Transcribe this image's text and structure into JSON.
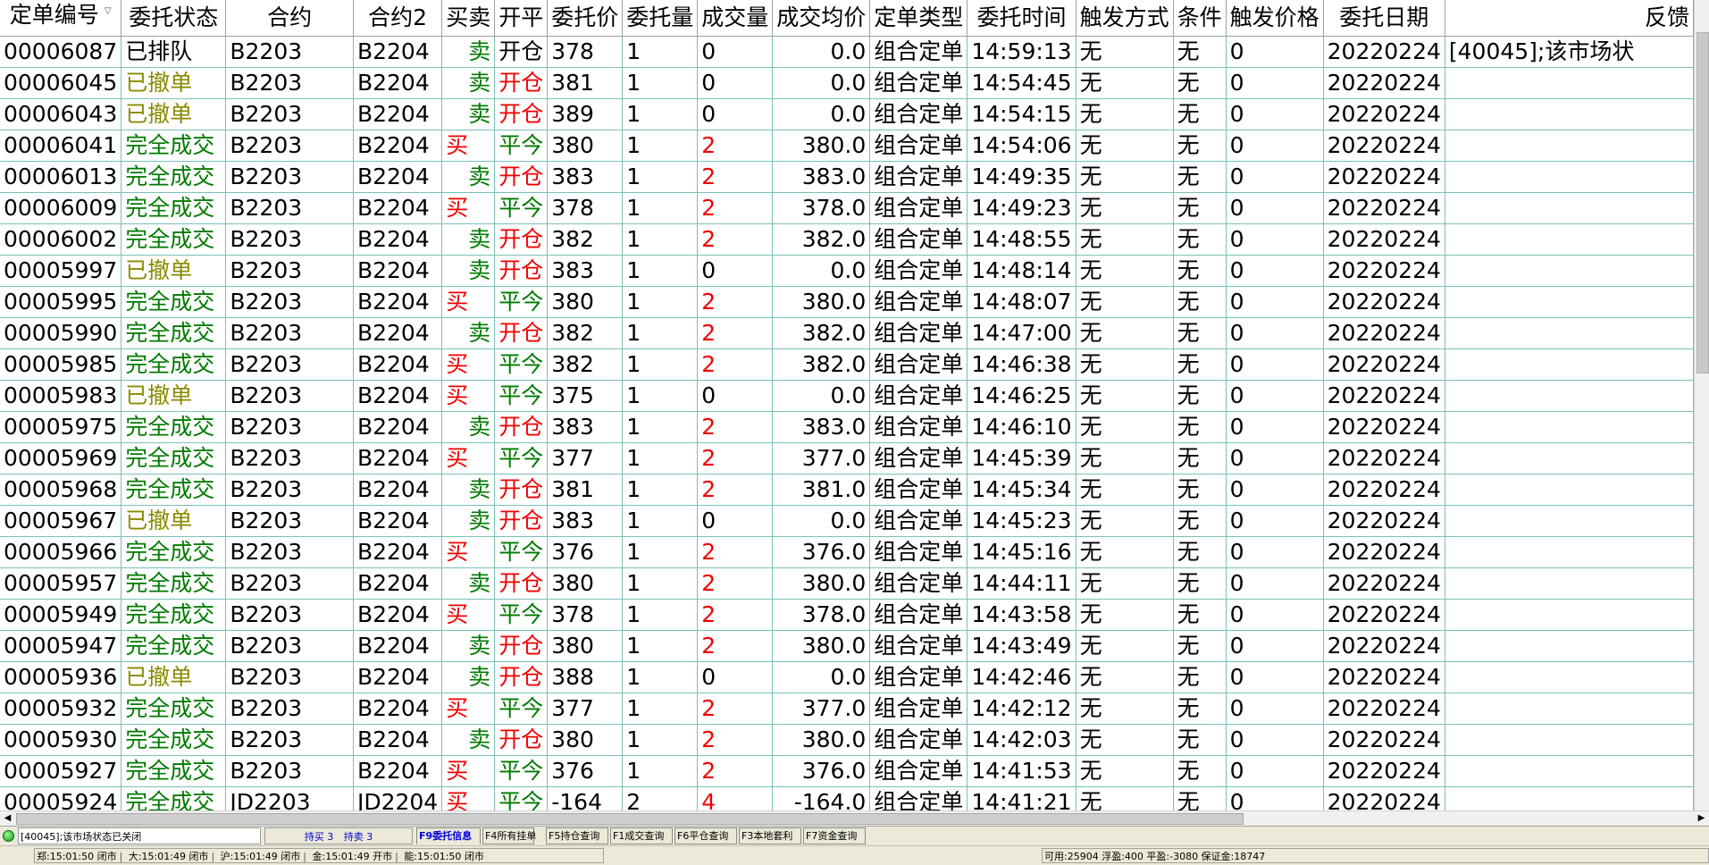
{
  "columns": [
    "定单编号",
    "委托状态",
    "合约",
    "合约2",
    "买卖",
    "开平",
    "委托价",
    "委托量",
    "成交量",
    "成交均价",
    "定单类型",
    "委托时间",
    "触发方式",
    "条件",
    "触发价格",
    "委托日期",
    "反馈"
  ],
  "sort_indicator": "▽",
  "colors": {
    "red": "#f00000",
    "green": "#007a00",
    "olive": "#8a8a00",
    "grid": "#7bbfb8"
  },
  "rows": [
    {
      "id": "00006087",
      "status": "已排队",
      "contract": "B2203",
      "contract2": "B2204",
      "side": "卖",
      "oc": "开仓",
      "price": "378",
      "qty": "1",
      "filled": "0",
      "avg": "0.0",
      "otype": "组合定单",
      "time": "14:59:13",
      "trigger": "无",
      "cond": "无",
      "tprice": "0",
      "date": "20220224",
      "feedback": "[40045];该市场状"
    },
    {
      "id": "00006045",
      "status": "已撤单",
      "contract": "B2203",
      "contract2": "B2204",
      "side": "卖",
      "oc": "开仓",
      "price": "381",
      "qty": "1",
      "filled": "0",
      "avg": "0.0",
      "otype": "组合定单",
      "time": "14:54:45",
      "trigger": "无",
      "cond": "无",
      "tprice": "0",
      "date": "20220224",
      "feedback": ""
    },
    {
      "id": "00006043",
      "status": "已撤单",
      "contract": "B2203",
      "contract2": "B2204",
      "side": "卖",
      "oc": "开仓",
      "price": "389",
      "qty": "1",
      "filled": "0",
      "avg": "0.0",
      "otype": "组合定单",
      "time": "14:54:15",
      "trigger": "无",
      "cond": "无",
      "tprice": "0",
      "date": "20220224",
      "feedback": ""
    },
    {
      "id": "00006041",
      "status": "完全成交",
      "contract": "B2203",
      "contract2": "B2204",
      "side": "买",
      "oc": "平今",
      "price": "380",
      "qty": "1",
      "filled": "2",
      "avg": "380.0",
      "otype": "组合定单",
      "time": "14:54:06",
      "trigger": "无",
      "cond": "无",
      "tprice": "0",
      "date": "20220224",
      "feedback": ""
    },
    {
      "id": "00006013",
      "status": "完全成交",
      "contract": "B2203",
      "contract2": "B2204",
      "side": "卖",
      "oc": "开仓",
      "price": "383",
      "qty": "1",
      "filled": "2",
      "avg": "383.0",
      "otype": "组合定单",
      "time": "14:49:35",
      "trigger": "无",
      "cond": "无",
      "tprice": "0",
      "date": "20220224",
      "feedback": ""
    },
    {
      "id": "00006009",
      "status": "完全成交",
      "contract": "B2203",
      "contract2": "B2204",
      "side": "买",
      "oc": "平今",
      "price": "378",
      "qty": "1",
      "filled": "2",
      "avg": "378.0",
      "otype": "组合定单",
      "time": "14:49:23",
      "trigger": "无",
      "cond": "无",
      "tprice": "0",
      "date": "20220224",
      "feedback": ""
    },
    {
      "id": "00006002",
      "status": "完全成交",
      "contract": "B2203",
      "contract2": "B2204",
      "side": "卖",
      "oc": "开仓",
      "price": "382",
      "qty": "1",
      "filled": "2",
      "avg": "382.0",
      "otype": "组合定单",
      "time": "14:48:55",
      "trigger": "无",
      "cond": "无",
      "tprice": "0",
      "date": "20220224",
      "feedback": ""
    },
    {
      "id": "00005997",
      "status": "已撤单",
      "contract": "B2203",
      "contract2": "B2204",
      "side": "卖",
      "oc": "开仓",
      "price": "383",
      "qty": "1",
      "filled": "0",
      "avg": "0.0",
      "otype": "组合定单",
      "time": "14:48:14",
      "trigger": "无",
      "cond": "无",
      "tprice": "0",
      "date": "20220224",
      "feedback": ""
    },
    {
      "id": "00005995",
      "status": "完全成交",
      "contract": "B2203",
      "contract2": "B2204",
      "side": "买",
      "oc": "平今",
      "price": "380",
      "qty": "1",
      "filled": "2",
      "avg": "380.0",
      "otype": "组合定单",
      "time": "14:48:07",
      "trigger": "无",
      "cond": "无",
      "tprice": "0",
      "date": "20220224",
      "feedback": ""
    },
    {
      "id": "00005990",
      "status": "完全成交",
      "contract": "B2203",
      "contract2": "B2204",
      "side": "卖",
      "oc": "开仓",
      "price": "382",
      "qty": "1",
      "filled": "2",
      "avg": "382.0",
      "otype": "组合定单",
      "time": "14:47:00",
      "trigger": "无",
      "cond": "无",
      "tprice": "0",
      "date": "20220224",
      "feedback": ""
    },
    {
      "id": "00005985",
      "status": "完全成交",
      "contract": "B2203",
      "contract2": "B2204",
      "side": "买",
      "oc": "平今",
      "price": "382",
      "qty": "1",
      "filled": "2",
      "avg": "382.0",
      "otype": "组合定单",
      "time": "14:46:38",
      "trigger": "无",
      "cond": "无",
      "tprice": "0",
      "date": "20220224",
      "feedback": ""
    },
    {
      "id": "00005983",
      "status": "已撤单",
      "contract": "B2203",
      "contract2": "B2204",
      "side": "买",
      "oc": "平今",
      "price": "375",
      "qty": "1",
      "filled": "0",
      "avg": "0.0",
      "otype": "组合定单",
      "time": "14:46:25",
      "trigger": "无",
      "cond": "无",
      "tprice": "0",
      "date": "20220224",
      "feedback": ""
    },
    {
      "id": "00005975",
      "status": "完全成交",
      "contract": "B2203",
      "contract2": "B2204",
      "side": "卖",
      "oc": "开仓",
      "price": "383",
      "qty": "1",
      "filled": "2",
      "avg": "383.0",
      "otype": "组合定单",
      "time": "14:46:10",
      "trigger": "无",
      "cond": "无",
      "tprice": "0",
      "date": "20220224",
      "feedback": ""
    },
    {
      "id": "00005969",
      "status": "完全成交",
      "contract": "B2203",
      "contract2": "B2204",
      "side": "买",
      "oc": "平今",
      "price": "377",
      "qty": "1",
      "filled": "2",
      "avg": "377.0",
      "otype": "组合定单",
      "time": "14:45:39",
      "trigger": "无",
      "cond": "无",
      "tprice": "0",
      "date": "20220224",
      "feedback": ""
    },
    {
      "id": "00005968",
      "status": "完全成交",
      "contract": "B2203",
      "contract2": "B2204",
      "side": "卖",
      "oc": "开仓",
      "price": "381",
      "qty": "1",
      "filled": "2",
      "avg": "381.0",
      "otype": "组合定单",
      "time": "14:45:34",
      "trigger": "无",
      "cond": "无",
      "tprice": "0",
      "date": "20220224",
      "feedback": ""
    },
    {
      "id": "00005967",
      "status": "已撤单",
      "contract": "B2203",
      "contract2": "B2204",
      "side": "卖",
      "oc": "开仓",
      "price": "383",
      "qty": "1",
      "filled": "0",
      "avg": "0.0",
      "otype": "组合定单",
      "time": "14:45:23",
      "trigger": "无",
      "cond": "无",
      "tprice": "0",
      "date": "20220224",
      "feedback": ""
    },
    {
      "id": "00005966",
      "status": "完全成交",
      "contract": "B2203",
      "contract2": "B2204",
      "side": "买",
      "oc": "平今",
      "price": "376",
      "qty": "1",
      "filled": "2",
      "avg": "376.0",
      "otype": "组合定单",
      "time": "14:45:16",
      "trigger": "无",
      "cond": "无",
      "tprice": "0",
      "date": "20220224",
      "feedback": ""
    },
    {
      "id": "00005957",
      "status": "完全成交",
      "contract": "B2203",
      "contract2": "B2204",
      "side": "卖",
      "oc": "开仓",
      "price": "380",
      "qty": "1",
      "filled": "2",
      "avg": "380.0",
      "otype": "组合定单",
      "time": "14:44:11",
      "trigger": "无",
      "cond": "无",
      "tprice": "0",
      "date": "20220224",
      "feedback": ""
    },
    {
      "id": "00005949",
      "status": "完全成交",
      "contract": "B2203",
      "contract2": "B2204",
      "side": "买",
      "oc": "平今",
      "price": "378",
      "qty": "1",
      "filled": "2",
      "avg": "378.0",
      "otype": "组合定单",
      "time": "14:43:58",
      "trigger": "无",
      "cond": "无",
      "tprice": "0",
      "date": "20220224",
      "feedback": ""
    },
    {
      "id": "00005947",
      "status": "完全成交",
      "contract": "B2203",
      "contract2": "B2204",
      "side": "卖",
      "oc": "开仓",
      "price": "380",
      "qty": "1",
      "filled": "2",
      "avg": "380.0",
      "otype": "组合定单",
      "time": "14:43:49",
      "trigger": "无",
      "cond": "无",
      "tprice": "0",
      "date": "20220224",
      "feedback": ""
    },
    {
      "id": "00005936",
      "status": "已撤单",
      "contract": "B2203",
      "contract2": "B2204",
      "side": "卖",
      "oc": "开仓",
      "price": "388",
      "qty": "1",
      "filled": "0",
      "avg": "0.0",
      "otype": "组合定单",
      "time": "14:42:46",
      "trigger": "无",
      "cond": "无",
      "tprice": "0",
      "date": "20220224",
      "feedback": ""
    },
    {
      "id": "00005932",
      "status": "完全成交",
      "contract": "B2203",
      "contract2": "B2204",
      "side": "买",
      "oc": "平今",
      "price": "377",
      "qty": "1",
      "filled": "2",
      "avg": "377.0",
      "otype": "组合定单",
      "time": "14:42:12",
      "trigger": "无",
      "cond": "无",
      "tprice": "0",
      "date": "20220224",
      "feedback": ""
    },
    {
      "id": "00005930",
      "status": "完全成交",
      "contract": "B2203",
      "contract2": "B2204",
      "side": "卖",
      "oc": "开仓",
      "price": "380",
      "qty": "1",
      "filled": "2",
      "avg": "380.0",
      "otype": "组合定单",
      "time": "14:42:03",
      "trigger": "无",
      "cond": "无",
      "tprice": "0",
      "date": "20220224",
      "feedback": ""
    },
    {
      "id": "00005927",
      "status": "完全成交",
      "contract": "B2203",
      "contract2": "B2204",
      "side": "买",
      "oc": "平今",
      "price": "376",
      "qty": "1",
      "filled": "2",
      "avg": "376.0",
      "otype": "组合定单",
      "time": "14:41:53",
      "trigger": "无",
      "cond": "无",
      "tprice": "0",
      "date": "20220224",
      "feedback": ""
    },
    {
      "id": "00005924",
      "status": "完全成交",
      "contract": "JD2203",
      "contract2": "JD2204",
      "side": "买",
      "oc": "平今",
      "price": "-164",
      "qty": "2",
      "filled": "4",
      "avg": "-164.0",
      "otype": "组合定单",
      "time": "14:41:21",
      "trigger": "无",
      "cond": "无",
      "tprice": "0",
      "date": "20220224",
      "feedback": ""
    }
  ],
  "scroll": {
    "left_arrow": "◀",
    "right_arrow": "▶"
  },
  "tabbar": {
    "message": "[40045];该市场状态已关闭",
    "hold_buy": "持买 3",
    "hold_sell": "持卖 3",
    "tabs": [
      "F9委托信息",
      "F4所有挂单",
      "F5持仓查询",
      "F1成交查询",
      "F6平仓查询",
      "F3本地套利",
      "F7资金查询"
    ],
    "active_tab": 0
  },
  "statusbar": {
    "markets": [
      "郑:15:01:50 闭市",
      "大:15:01:49 闭市",
      "沪:15:01:49 闭市",
      "金:15:01:49 开市",
      "能:15:01:50 闭市"
    ],
    "account": "可用:25904 浮盈:400 平盈:-3080 保证金:18747"
  }
}
